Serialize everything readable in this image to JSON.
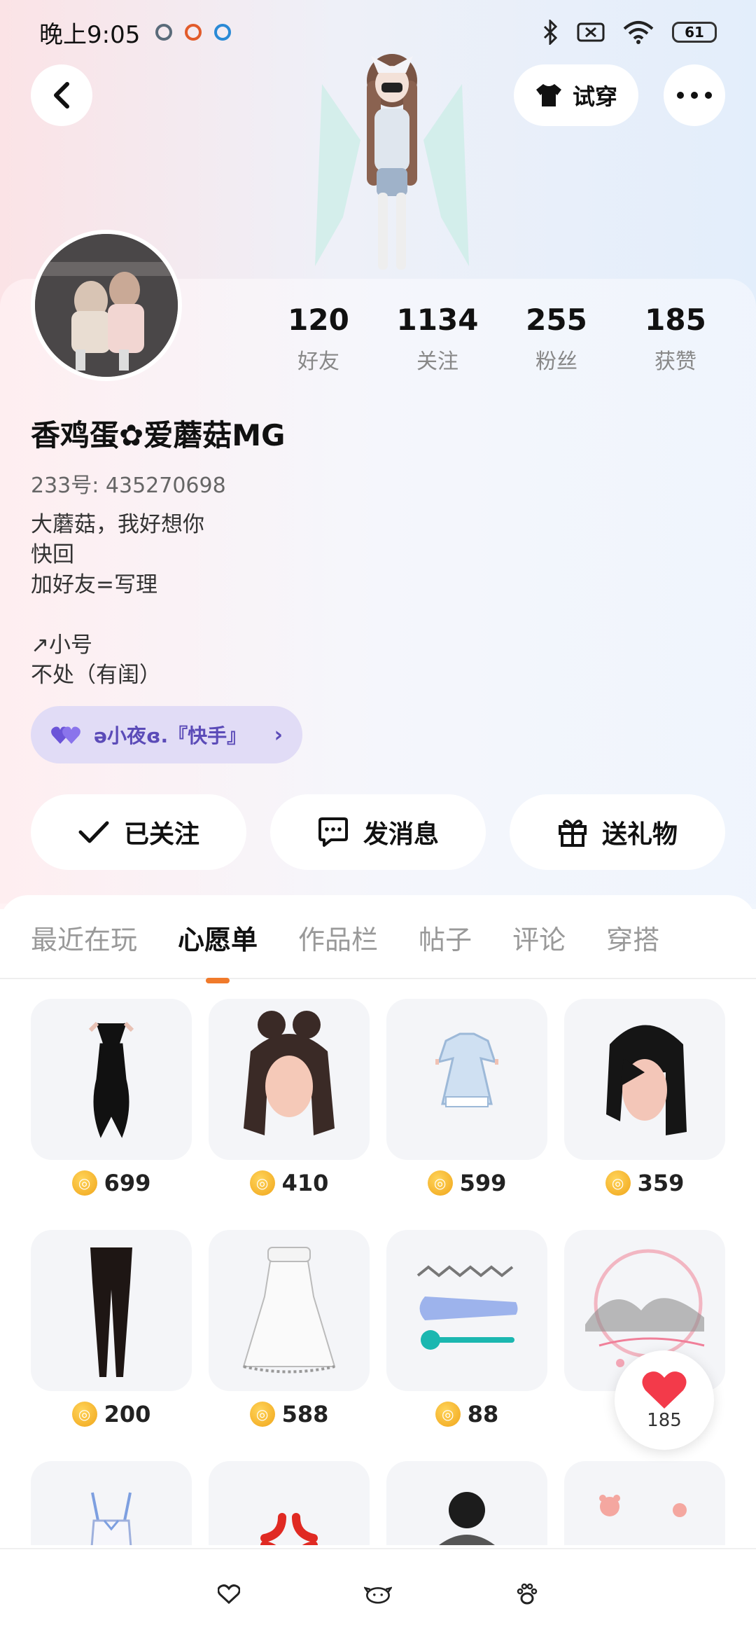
{
  "status_bar": {
    "time": "晚上9:05",
    "battery": "61",
    "icons": [
      "notification-icon-1",
      "notification-icon-2",
      "notification-icon-3",
      "bluetooth-icon",
      "sim-off-icon",
      "wifi-icon",
      "battery-icon"
    ]
  },
  "header": {
    "back_icon": "chevron-left-icon",
    "try_on_label": "试穿",
    "more_icon": "more-dots-icon"
  },
  "profile": {
    "stats": [
      {
        "num": "120",
        "label": "好友"
      },
      {
        "num": "1134",
        "label": "关注"
      },
      {
        "num": "255",
        "label": "粉丝"
      },
      {
        "num": "185",
        "label": "获赞"
      }
    ],
    "nickname": "香鸡蛋✿爱蘑菇MG",
    "uid": "233号: 435270698",
    "bio": "大蘑菇，我好想你\n快回\n加好友=写理\n\n↗小号\n不处（有闺）",
    "cp_tag": "ə小夜ɞ.『快手』"
  },
  "actions": {
    "follow": "已关注",
    "message": "发消息",
    "gift": "送礼物"
  },
  "tabs": [
    {
      "label": "最近在玩",
      "active": false
    },
    {
      "label": "心愿单",
      "active": true
    },
    {
      "label": "作品栏",
      "active": false
    },
    {
      "label": "帖子",
      "active": false
    },
    {
      "label": "评论",
      "active": false
    },
    {
      "label": "穿搭",
      "active": false
    }
  ],
  "wishlist": [
    {
      "name": "black-dress",
      "price": "699"
    },
    {
      "name": "bun-hair",
      "price": "410"
    },
    {
      "name": "blue-lolita-dress",
      "price": "599"
    },
    {
      "name": "black-short-hair",
      "price": "359"
    },
    {
      "name": "black-tights",
      "price": "200"
    },
    {
      "name": "white-tutu-dress",
      "price": "588"
    },
    {
      "name": "hair-clips",
      "price": "88"
    },
    {
      "name": "ink-landscape-bg",
      "price": ""
    },
    {
      "name": "white-camisole",
      "price": ""
    },
    {
      "name": "anger-symbol",
      "price": ""
    },
    {
      "name": "striped-outfit",
      "price": ""
    },
    {
      "name": "bear-stickers",
      "price": ""
    }
  ],
  "like_float": {
    "count": "185"
  },
  "colors": {
    "accent": "#f07a2b",
    "cp_bg": "#e1dcf6",
    "cp_text": "#5b4bb8",
    "like": "#f33a4a",
    "coin": "#f0a51a"
  }
}
